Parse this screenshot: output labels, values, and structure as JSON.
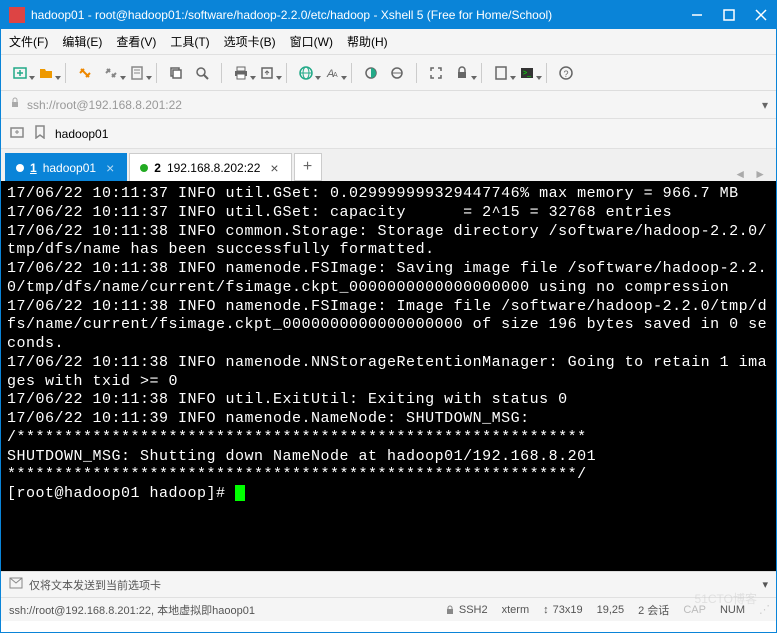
{
  "window": {
    "title": "hadoop01 - root@hadoop01:/software/hadoop-2.2.0/etc/hadoop - Xshell 5 (Free for Home/School)"
  },
  "menu": {
    "file": "文件(F)",
    "edit": "编辑(E)",
    "view": "查看(V)",
    "tools": "工具(T)",
    "tab": "选项卡(B)",
    "window": "窗口(W)",
    "help": "帮助(H)"
  },
  "address": {
    "text": "ssh://root@192.168.8.201:22"
  },
  "session": {
    "name": "hadoop01"
  },
  "tabs": {
    "t1_num": "1",
    "t1_label": "hadoop01",
    "t2_num": "2",
    "t2_label": "192.168.8.202:22",
    "add": "+"
  },
  "term": {
    "lines": [
      "17/06/22 10:11:37 INFO util.GSet: 0.029999999329447746% max memory = 966.7 MB",
      "17/06/22 10:11:37 INFO util.GSet: capacity      = 2^15 = 32768 entries",
      "17/06/22 10:11:38 INFO common.Storage: Storage directory /software/hadoop-2.2.0/tmp/dfs/name has been successfully formatted.",
      "17/06/22 10:11:38 INFO namenode.FSImage: Saving image file /software/hadoop-2.2.0/tmp/dfs/name/current/fsimage.ckpt_0000000000000000000 using no compression",
      "17/06/22 10:11:38 INFO namenode.FSImage: Image file /software/hadoop-2.2.0/tmp/dfs/name/current/fsimage.ckpt_0000000000000000000 of size 196 bytes saved in 0 seconds.",
      "17/06/22 10:11:38 INFO namenode.NNStorageRetentionManager: Going to retain 1 images with txid >= 0",
      "17/06/22 10:11:38 INFO util.ExitUtil: Exiting with status 0",
      "17/06/22 10:11:39 INFO namenode.NameNode: SHUTDOWN_MSG:",
      "/************************************************************",
      "SHUTDOWN_MSG: Shutting down NameNode at hadoop01/192.168.8.201",
      "************************************************************/",
      "[root@hadoop01 hadoop]# "
    ]
  },
  "footer": {
    "send_label": "仅将文本发送到当前选项卡",
    "conn": "ssh://root@192.168.8.201:22, 本地虚拟即haoop01",
    "proto": "SSH2",
    "termtype": "xterm",
    "size": "73x19",
    "pos": "19,25",
    "sess": "2 会话",
    "cap": "CAP",
    "num": "NUM",
    "wm": "51CTO博客"
  }
}
